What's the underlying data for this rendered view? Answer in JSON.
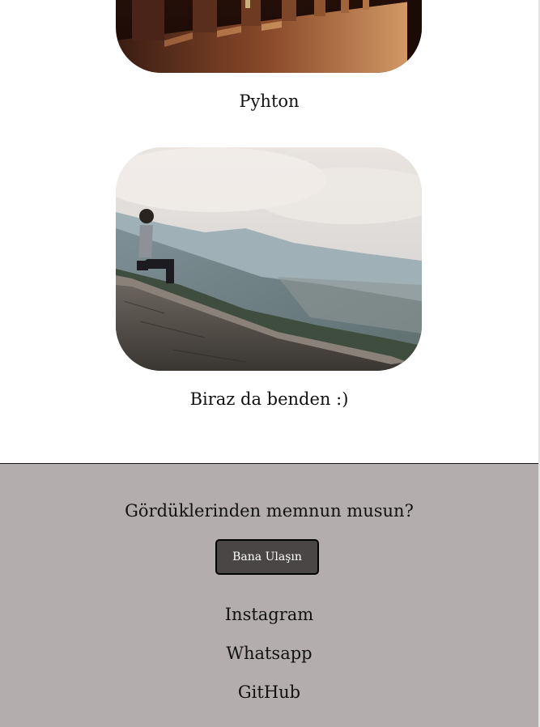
{
  "gallery": {
    "items": [
      {
        "caption": "Pyhton"
      },
      {
        "caption": "Biraz da benden :)"
      }
    ]
  },
  "footer": {
    "question": "Gördüklerinden memnun musun?",
    "contact_button_label": "Bana Ulaşın",
    "links": [
      {
        "label": "Instagram"
      },
      {
        "label": "Whatsapp"
      },
      {
        "label": "GitHub"
      }
    ],
    "background_color": "#b3adad",
    "button_color": "#4a4646"
  }
}
